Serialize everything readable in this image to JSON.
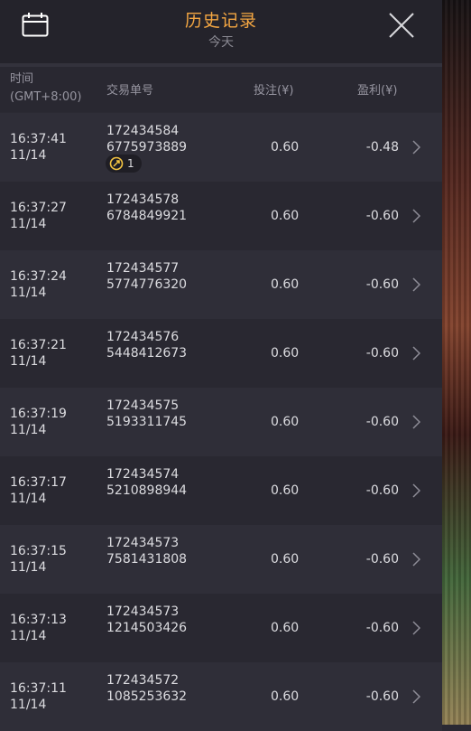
{
  "header": {
    "title": "历史记录",
    "subtitle": "今天"
  },
  "columns": {
    "time_line1": "时间",
    "time_line2": "(GMT+8:00)",
    "order": "交易单号",
    "bet": "投注(¥)",
    "profit": "盈利(¥)"
  },
  "rows": [
    {
      "time": "16:37:41",
      "date": "11/14",
      "order1": "172434584",
      "order2": "6775973889",
      "bet": "0.60",
      "profit": "-0.48",
      "badge": "1"
    },
    {
      "time": "16:37:27",
      "date": "11/14",
      "order1": "172434578",
      "order2": "6784849921",
      "bet": "0.60",
      "profit": "-0.60"
    },
    {
      "time": "16:37:24",
      "date": "11/14",
      "order1": "172434577",
      "order2": "5774776320",
      "bet": "0.60",
      "profit": "-0.60"
    },
    {
      "time": "16:37:21",
      "date": "11/14",
      "order1": "172434576",
      "order2": "5448412673",
      "bet": "0.60",
      "profit": "-0.60"
    },
    {
      "time": "16:37:19",
      "date": "11/14",
      "order1": "172434575",
      "order2": "5193311745",
      "bet": "0.60",
      "profit": "-0.60"
    },
    {
      "time": "16:37:17",
      "date": "11/14",
      "order1": "172434574",
      "order2": "5210898944",
      "bet": "0.60",
      "profit": "-0.60"
    },
    {
      "time": "16:37:15",
      "date": "11/14",
      "order1": "172434573",
      "order2": "7581431808",
      "bet": "0.60",
      "profit": "-0.60"
    },
    {
      "time": "16:37:13",
      "date": "11/14",
      "order1": "172434573",
      "order2": "1214503426",
      "bet": "0.60",
      "profit": "-0.60"
    },
    {
      "time": "16:37:11",
      "date": "11/14",
      "order1": "172434572",
      "order2": "1085253632",
      "bet": "0.60",
      "profit": "-0.60"
    }
  ],
  "colors": {
    "accent": "#f5a742",
    "panel_bg": "#2b2a33",
    "row_alt": "#2f2e38"
  },
  "icons": {
    "calendar": "calendar-icon",
    "close": "close-icon",
    "chevron": "chevron-right-icon",
    "badge": "free-spin-icon"
  }
}
